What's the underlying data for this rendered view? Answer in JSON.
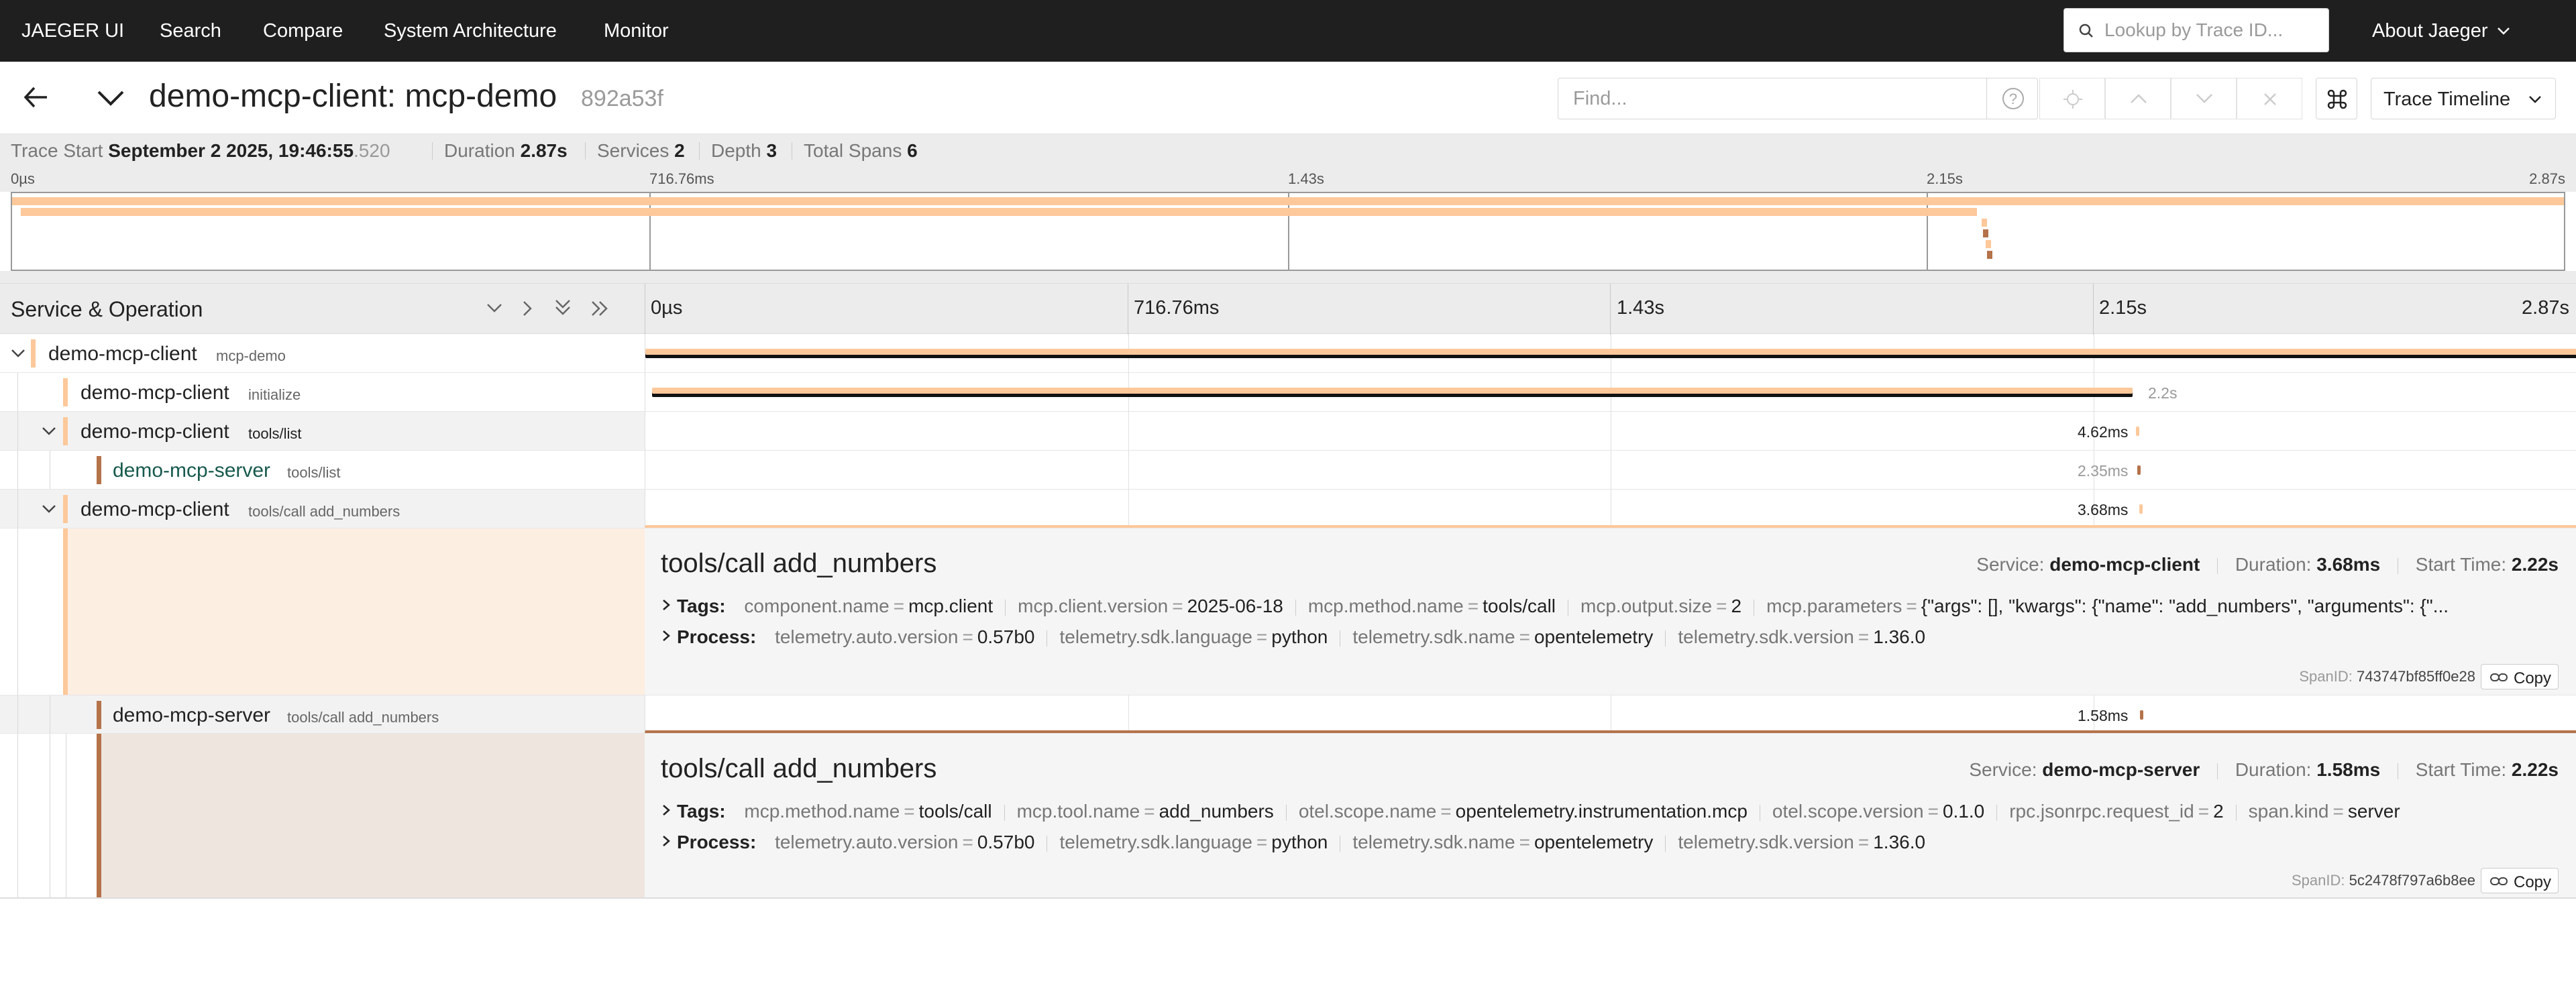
{
  "nav": {
    "brand": "JAEGER UI",
    "links": [
      "Search",
      "Compare",
      "System Architecture",
      "Monitor"
    ],
    "lookup_placeholder": "Lookup by Trace ID...",
    "about": "About Jaeger"
  },
  "trace": {
    "title": "demo-mcp-client: mcp-demo",
    "id": "892a53f",
    "find_placeholder": "Find...",
    "view": "Trace Timeline"
  },
  "summary": {
    "start_label": "Trace Start",
    "start_value": "September 2 2025, 19:46:55",
    "start_ms": ".520",
    "duration_label": "Duration",
    "duration_value": "2.87s",
    "services_label": "Services",
    "services_value": "2",
    "depth_label": "Depth",
    "depth_value": "3",
    "total_label": "Total Spans",
    "total_value": "6"
  },
  "ticks": [
    "0µs",
    "716.76ms",
    "1.43s",
    "2.15s",
    "2.87s"
  ],
  "header": {
    "title": "Service & Operation"
  },
  "colors": {
    "client": "#fdc89a",
    "server": "#b5734a",
    "client_fill": "#fdeee2",
    "server_fill": "#efe5df"
  },
  "spans": [
    {
      "service": "demo-mcp-client",
      "operation": "mcp-demo",
      "start": 0.0,
      "duration": 2.87,
      "label": ""
    },
    {
      "service": "demo-mcp-client",
      "operation": "initialize",
      "start": 0.01,
      "duration": 2.2,
      "label": "2.2s"
    },
    {
      "service": "demo-mcp-client",
      "operation": "tools/list",
      "start": 2.215,
      "duration": 0.00462,
      "label": "4.62ms"
    },
    {
      "service": "demo-mcp-server",
      "operation": "tools/list",
      "start": 2.217,
      "duration": 0.00235,
      "label": "2.35ms"
    },
    {
      "service": "demo-mcp-client",
      "operation": "tools/call add_numbers",
      "start": 2.22,
      "duration": 0.00368,
      "label": "3.68ms"
    },
    {
      "service": "demo-mcp-server",
      "operation": "tools/call add_numbers",
      "start": 2.221,
      "duration": 0.00158,
      "label": "1.58ms"
    }
  ],
  "details": [
    {
      "title": "tools/call add_numbers",
      "service_label": "Service:",
      "service": "demo-mcp-client",
      "duration_label": "Duration:",
      "duration": "3.68ms",
      "start_label": "Start Time:",
      "start": "2.22s",
      "tags_label": "Tags:",
      "tags": [
        {
          "k": "component.name",
          "v": "mcp.client"
        },
        {
          "k": "mcp.client.version",
          "v": "2025-06-18"
        },
        {
          "k": "mcp.method.name",
          "v": "tools/call"
        },
        {
          "k": "mcp.output.size",
          "v": "2"
        },
        {
          "k": "mcp.parameters",
          "v": "{\"args\": [], \"kwargs\": {\"name\": \"add_numbers\", \"arguments\": {\"..."
        }
      ],
      "process_label": "Process:",
      "process": [
        {
          "k": "telemetry.auto.version",
          "v": "0.57b0"
        },
        {
          "k": "telemetry.sdk.language",
          "v": "python"
        },
        {
          "k": "telemetry.sdk.name",
          "v": "opentelemetry"
        },
        {
          "k": "telemetry.sdk.version",
          "v": "1.36.0"
        }
      ],
      "spanid_label": "SpanID:",
      "spanid": "743747bf85ff0e28",
      "copy": "Copy"
    },
    {
      "title": "tools/call add_numbers",
      "service_label": "Service:",
      "service": "demo-mcp-server",
      "duration_label": "Duration:",
      "duration": "1.58ms",
      "start_label": "Start Time:",
      "start": "2.22s",
      "tags_label": "Tags:",
      "tags": [
        {
          "k": "mcp.method.name",
          "v": "tools/call"
        },
        {
          "k": "mcp.tool.name",
          "v": "add_numbers"
        },
        {
          "k": "otel.scope.name",
          "v": "opentelemetry.instrumentation.mcp"
        },
        {
          "k": "otel.scope.version",
          "v": "0.1.0"
        },
        {
          "k": "rpc.jsonrpc.request_id",
          "v": "2"
        },
        {
          "k": "span.kind",
          "v": "server"
        }
      ],
      "process_label": "Process:",
      "process": [
        {
          "k": "telemetry.auto.version",
          "v": "0.57b0"
        },
        {
          "k": "telemetry.sdk.language",
          "v": "python"
        },
        {
          "k": "telemetry.sdk.name",
          "v": "opentelemetry"
        },
        {
          "k": "telemetry.sdk.version",
          "v": "1.36.0"
        }
      ],
      "spanid_label": "SpanID:",
      "spanid": "5c2478f797a6b8ee",
      "copy": "Copy"
    }
  ]
}
